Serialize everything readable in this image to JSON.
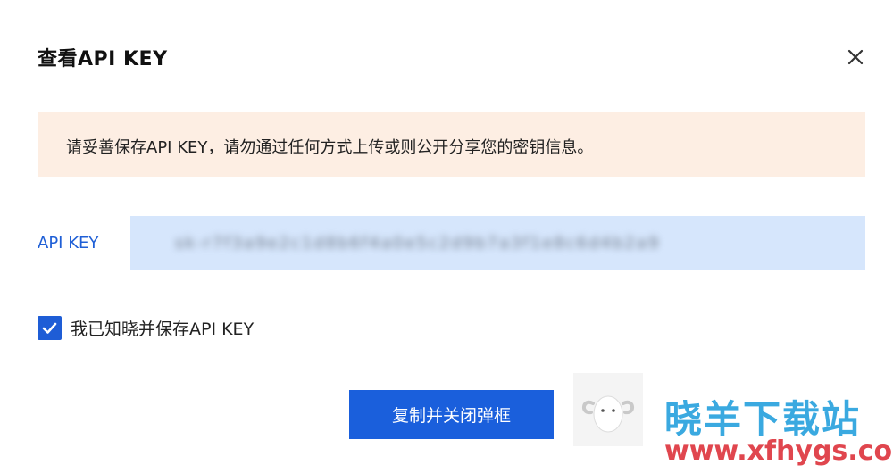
{
  "dialog": {
    "title": "查看API KEY",
    "close_icon": "close-icon"
  },
  "warning": {
    "text": "请妥善保存API KEY，请勿通过任何方式上传或则公开分享您的密钥信息。",
    "background": "#fdeee3"
  },
  "api_key": {
    "label": "API KEY",
    "value": "sk-r7f3a9e2c1d8b6f4a0e5c2d9b7a3f1e8c6d4b2a9"
  },
  "ack": {
    "checked": true,
    "label": "我已知晓并保存API KEY"
  },
  "actions": {
    "copy_close_label": "复制并关闭弹框"
  },
  "watermark": {
    "title": "晓羊下载站",
    "url": "www.xfhygs.com"
  },
  "colors": {
    "accent": "#1a5fdc",
    "key_field_bg": "#d6e6fc",
    "label_blue": "#1f5fd6"
  }
}
